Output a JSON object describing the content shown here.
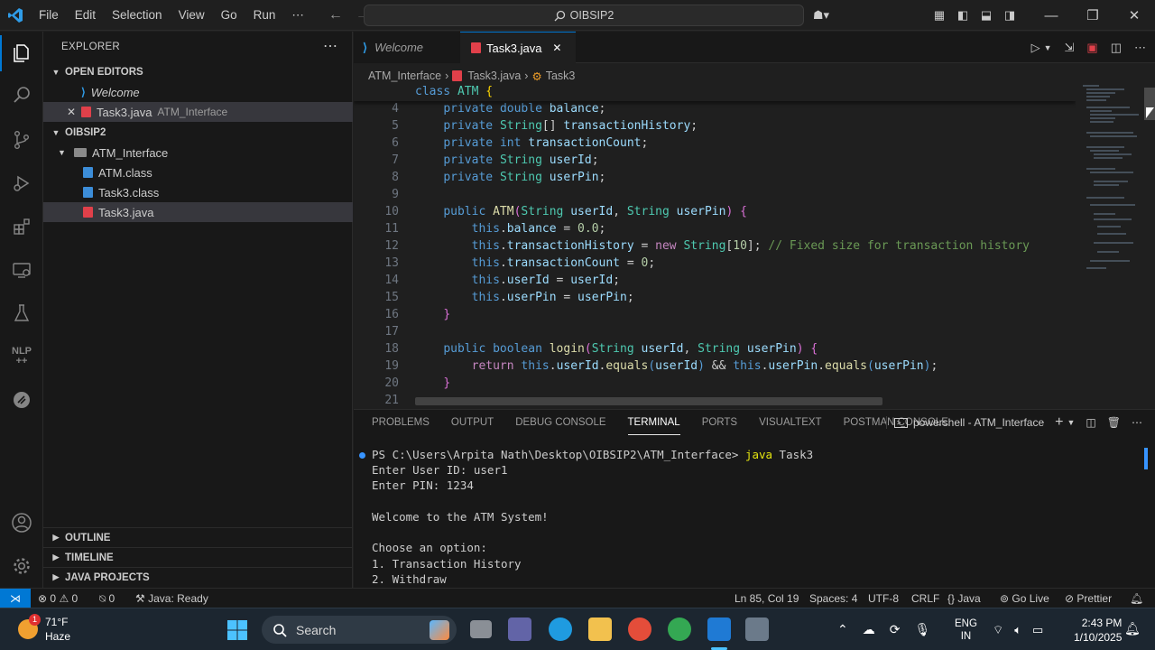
{
  "titlebar": {
    "menu": [
      "File",
      "Edit",
      "Selection",
      "View",
      "Go",
      "Run",
      "⋯"
    ],
    "search": "OIBSIP2"
  },
  "sidebar": {
    "title": "EXPLORER",
    "open_editors_label": "OPEN EDITORS",
    "open_editors": [
      {
        "name": "Welcome",
        "sub": ""
      },
      {
        "name": "Task3.java",
        "sub": "ATM_Interface"
      }
    ],
    "workspace_label": "OIBSIP2",
    "folder": "ATM_Interface",
    "files": [
      "ATM.class",
      "Task3.class",
      "Task3.java"
    ],
    "outline_label": "OUTLINE",
    "timeline_label": "TIMELINE",
    "java_projects_label": "JAVA PROJECTS"
  },
  "tabs": [
    {
      "label": "Welcome"
    },
    {
      "label": "Task3.java"
    }
  ],
  "breadcrumb": [
    "ATM_Interface",
    "Task3.java",
    "Task3"
  ],
  "code_line_numbers": [
    "3",
    "4",
    "5",
    "6",
    "7",
    "8",
    "9",
    "10",
    "11",
    "12",
    "13",
    "14",
    "15",
    "16",
    "17",
    "18",
    "19",
    "20",
    "21"
  ],
  "panel": {
    "tabs": [
      "PROBLEMS",
      "OUTPUT",
      "DEBUG CONSOLE",
      "TERMINAL",
      "PORTS",
      "VISUALTEXT",
      "POSTMAN CONSOLE"
    ],
    "shell": "powershell - ATM_Interface",
    "terminal": {
      "prompt": "PS C:\\Users\\Arpita Nath\\Desktop\\OIBSIP2\\ATM_Interface> ",
      "command": "java",
      "arg": " Task3",
      "lines": [
        "Enter User ID: user1",
        "Enter PIN: 1234",
        "",
        "Welcome to the ATM System!",
        "",
        "Choose an option:",
        "1. Transaction History",
        "2. Withdraw"
      ]
    }
  },
  "statusbar": {
    "errors": "0",
    "warnings": "0",
    "ports": "0",
    "java": "Java: Ready",
    "position": "Ln 85, Col 19",
    "spaces": "Spaces: 4",
    "encoding": "UTF-8",
    "eol": "CRLF",
    "language": "Java",
    "golive": "Go Live",
    "prettier": "Prettier"
  },
  "taskbar": {
    "weather_temp": "71°F",
    "weather_desc": "Haze",
    "badge": "1",
    "search_placeholder": "Search",
    "lang": "ENG",
    "region": "IN",
    "time": "2:43 PM",
    "date": "1/10/2025"
  },
  "colors": {
    "accent": "#0078d4",
    "java_file": "#e0404a",
    "class_file": "#3c8dd8"
  }
}
